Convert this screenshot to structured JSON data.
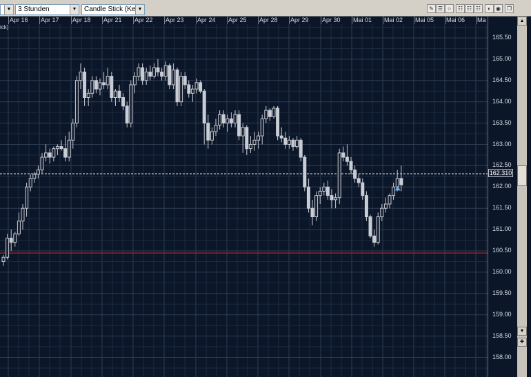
{
  "toolbar": {
    "interval": "3 Stunden",
    "chart_type": "Candle Stick (Kerze"
  },
  "date_labels": [
    "Apr 16",
    "Apr 17",
    "Apr 18",
    "Apr 21",
    "Apr 22",
    "Apr 23",
    "Apr 24",
    "Apr 25",
    "Apr 28",
    "Apr 29",
    "Apr 30",
    "Mai 01",
    "Mai 02",
    "Mai 05",
    "Mai 06",
    "Ma"
  ],
  "partial_label": "ick)",
  "price_labels": [
    "165.50",
    "165.00",
    "164.50",
    "164.00",
    "163.50",
    "163.00",
    "162.50",
    "162.00",
    "161.50",
    "161.00",
    "160.50",
    "160.00",
    "159.50",
    "159.00",
    "158.50",
    "158.00"
  ],
  "current_price": "162.310",
  "reference_price": 160.45,
  "colors": {
    "background": "#0b1628",
    "candle_up": "#1a2030",
    "candle_down": "#c8ccd4",
    "reference_line": "#b0242a",
    "current_line": "#ffffff",
    "marker": "#6fa8e8"
  },
  "chart_data": {
    "type": "candlestick",
    "ylim": [
      157.7,
      165.8
    ],
    "x_labels": [
      "Apr 16",
      "Apr 17",
      "Apr 18",
      "Apr 21",
      "Apr 22",
      "Apr 23",
      "Apr 24",
      "Apr 25",
      "Apr 28",
      "Apr 29",
      "Apr 30",
      "Mai 01",
      "Mai 02",
      "Mai 05",
      "Mai 06"
    ],
    "candles": [
      {
        "o": 160.25,
        "h": 160.4,
        "l": 160.15,
        "c": 160.35
      },
      {
        "o": 160.35,
        "h": 160.9,
        "l": 160.3,
        "c": 160.8
      },
      {
        "o": 160.8,
        "h": 161.0,
        "l": 160.5,
        "c": 160.7
      },
      {
        "o": 160.7,
        "h": 160.95,
        "l": 160.6,
        "c": 160.9
      },
      {
        "o": 160.9,
        "h": 161.4,
        "l": 160.85,
        "c": 161.2
      },
      {
        "o": 161.2,
        "h": 161.6,
        "l": 161.0,
        "c": 161.5
      },
      {
        "o": 161.5,
        "h": 162.1,
        "l": 161.3,
        "c": 162.0
      },
      {
        "o": 162.0,
        "h": 162.3,
        "l": 161.9,
        "c": 162.2
      },
      {
        "o": 162.2,
        "h": 162.35,
        "l": 162.1,
        "c": 162.3
      },
      {
        "o": 162.3,
        "h": 162.5,
        "l": 162.2,
        "c": 162.4
      },
      {
        "o": 162.4,
        "h": 162.8,
        "l": 162.3,
        "c": 162.7
      },
      {
        "o": 162.7,
        "h": 163.0,
        "l": 162.6,
        "c": 162.8
      },
      {
        "o": 162.8,
        "h": 162.9,
        "l": 162.55,
        "c": 162.7
      },
      {
        "o": 162.7,
        "h": 162.95,
        "l": 162.6,
        "c": 162.9
      },
      {
        "o": 162.9,
        "h": 163.0,
        "l": 162.75,
        "c": 162.95
      },
      {
        "o": 162.95,
        "h": 163.1,
        "l": 162.85,
        "c": 162.9
      },
      {
        "o": 162.9,
        "h": 163.2,
        "l": 162.6,
        "c": 162.7
      },
      {
        "o": 162.7,
        "h": 163.3,
        "l": 162.6,
        "c": 163.1
      },
      {
        "o": 163.1,
        "h": 163.6,
        "l": 162.9,
        "c": 163.5
      },
      {
        "o": 163.5,
        "h": 164.6,
        "l": 163.4,
        "c": 164.5
      },
      {
        "o": 164.5,
        "h": 164.9,
        "l": 164.3,
        "c": 164.7
      },
      {
        "o": 164.7,
        "h": 164.8,
        "l": 163.9,
        "c": 164.1
      },
      {
        "o": 164.1,
        "h": 164.3,
        "l": 163.9,
        "c": 164.2
      },
      {
        "o": 164.2,
        "h": 164.6,
        "l": 164.1,
        "c": 164.5
      },
      {
        "o": 164.5,
        "h": 164.6,
        "l": 164.2,
        "c": 164.3
      },
      {
        "o": 164.3,
        "h": 164.55,
        "l": 164.15,
        "c": 164.45
      },
      {
        "o": 164.45,
        "h": 164.7,
        "l": 164.3,
        "c": 164.4
      },
      {
        "o": 164.4,
        "h": 164.8,
        "l": 164.3,
        "c": 164.6
      },
      {
        "o": 164.6,
        "h": 164.7,
        "l": 164.0,
        "c": 164.1
      },
      {
        "o": 164.1,
        "h": 164.3,
        "l": 163.9,
        "c": 164.25
      },
      {
        "o": 164.25,
        "h": 164.4,
        "l": 164.0,
        "c": 164.1
      },
      {
        "o": 164.1,
        "h": 164.2,
        "l": 163.8,
        "c": 163.9
      },
      {
        "o": 163.9,
        "h": 164.0,
        "l": 163.4,
        "c": 163.5
      },
      {
        "o": 163.5,
        "h": 164.5,
        "l": 163.4,
        "c": 164.4
      },
      {
        "o": 164.4,
        "h": 164.7,
        "l": 164.2,
        "c": 164.6
      },
      {
        "o": 164.6,
        "h": 164.9,
        "l": 164.5,
        "c": 164.8
      },
      {
        "o": 164.8,
        "h": 164.9,
        "l": 164.4,
        "c": 164.5
      },
      {
        "o": 164.5,
        "h": 164.8,
        "l": 164.4,
        "c": 164.7
      },
      {
        "o": 164.7,
        "h": 164.85,
        "l": 164.5,
        "c": 164.6
      },
      {
        "o": 164.6,
        "h": 164.9,
        "l": 164.55,
        "c": 164.8
      },
      {
        "o": 164.8,
        "h": 165.0,
        "l": 164.6,
        "c": 164.7
      },
      {
        "o": 164.7,
        "h": 164.8,
        "l": 164.5,
        "c": 164.6
      },
      {
        "o": 164.6,
        "h": 164.95,
        "l": 164.5,
        "c": 164.85
      },
      {
        "o": 164.85,
        "h": 164.9,
        "l": 164.3,
        "c": 164.4
      },
      {
        "o": 164.4,
        "h": 164.9,
        "l": 164.3,
        "c": 164.75
      },
      {
        "o": 164.75,
        "h": 164.8,
        "l": 163.9,
        "c": 164.0
      },
      {
        "o": 164.0,
        "h": 164.7,
        "l": 163.9,
        "c": 164.6
      },
      {
        "o": 164.6,
        "h": 164.7,
        "l": 164.3,
        "c": 164.4
      },
      {
        "o": 164.4,
        "h": 164.5,
        "l": 164.1,
        "c": 164.2
      },
      {
        "o": 164.2,
        "h": 164.4,
        "l": 164.0,
        "c": 164.3
      },
      {
        "o": 164.3,
        "h": 164.55,
        "l": 164.2,
        "c": 164.45
      },
      {
        "o": 164.45,
        "h": 164.5,
        "l": 164.2,
        "c": 164.25
      },
      {
        "o": 164.25,
        "h": 164.3,
        "l": 163.0,
        "c": 163.5
      },
      {
        "o": 163.5,
        "h": 163.7,
        "l": 162.9,
        "c": 163.1
      },
      {
        "o": 163.1,
        "h": 163.4,
        "l": 163.0,
        "c": 163.3
      },
      {
        "o": 163.3,
        "h": 163.6,
        "l": 163.2,
        "c": 163.45
      },
      {
        "o": 163.45,
        "h": 163.8,
        "l": 163.35,
        "c": 163.7
      },
      {
        "o": 163.7,
        "h": 163.8,
        "l": 163.4,
        "c": 163.5
      },
      {
        "o": 163.5,
        "h": 163.7,
        "l": 163.3,
        "c": 163.6
      },
      {
        "o": 163.6,
        "h": 163.75,
        "l": 163.4,
        "c": 163.5
      },
      {
        "o": 163.5,
        "h": 163.8,
        "l": 163.4,
        "c": 163.7
      },
      {
        "o": 163.7,
        "h": 163.8,
        "l": 163.1,
        "c": 163.2
      },
      {
        "o": 163.2,
        "h": 163.5,
        "l": 162.8,
        "c": 163.4
      },
      {
        "o": 163.4,
        "h": 163.45,
        "l": 162.75,
        "c": 162.9
      },
      {
        "o": 162.9,
        "h": 163.2,
        "l": 162.8,
        "c": 163.0
      },
      {
        "o": 163.0,
        "h": 163.3,
        "l": 162.85,
        "c": 163.1
      },
      {
        "o": 163.1,
        "h": 163.3,
        "l": 162.9,
        "c": 163.2
      },
      {
        "o": 163.2,
        "h": 163.7,
        "l": 163.0,
        "c": 163.6
      },
      {
        "o": 163.6,
        "h": 163.9,
        "l": 163.5,
        "c": 163.8
      },
      {
        "o": 163.8,
        "h": 163.85,
        "l": 163.55,
        "c": 163.65
      },
      {
        "o": 163.65,
        "h": 163.9,
        "l": 163.6,
        "c": 163.85
      },
      {
        "o": 163.85,
        "h": 163.9,
        "l": 163.1,
        "c": 163.2
      },
      {
        "o": 163.2,
        "h": 163.4,
        "l": 163.05,
        "c": 163.15
      },
      {
        "o": 163.15,
        "h": 163.3,
        "l": 162.9,
        "c": 163.0
      },
      {
        "o": 163.0,
        "h": 163.2,
        "l": 162.9,
        "c": 163.1
      },
      {
        "o": 163.1,
        "h": 163.15,
        "l": 162.85,
        "c": 162.95
      },
      {
        "o": 162.95,
        "h": 163.2,
        "l": 162.9,
        "c": 163.1
      },
      {
        "o": 163.1,
        "h": 163.15,
        "l": 162.6,
        "c": 162.7
      },
      {
        "o": 162.7,
        "h": 162.75,
        "l": 161.9,
        "c": 162.0
      },
      {
        "o": 162.0,
        "h": 162.2,
        "l": 161.4,
        "c": 161.5
      },
      {
        "o": 161.5,
        "h": 161.7,
        "l": 161.1,
        "c": 161.3
      },
      {
        "o": 161.3,
        "h": 161.9,
        "l": 161.2,
        "c": 161.8
      },
      {
        "o": 161.8,
        "h": 162.0,
        "l": 161.6,
        "c": 161.9
      },
      {
        "o": 161.9,
        "h": 162.1,
        "l": 161.8,
        "c": 162.0
      },
      {
        "o": 162.0,
        "h": 162.15,
        "l": 161.7,
        "c": 161.8
      },
      {
        "o": 161.8,
        "h": 161.95,
        "l": 161.5,
        "c": 161.7
      },
      {
        "o": 161.7,
        "h": 161.85,
        "l": 161.5,
        "c": 161.75
      },
      {
        "o": 161.75,
        "h": 162.9,
        "l": 161.6,
        "c": 162.8
      },
      {
        "o": 162.8,
        "h": 162.95,
        "l": 162.6,
        "c": 162.7
      },
      {
        "o": 162.7,
        "h": 163.0,
        "l": 162.5,
        "c": 162.6
      },
      {
        "o": 162.6,
        "h": 162.7,
        "l": 162.3,
        "c": 162.4
      },
      {
        "o": 162.4,
        "h": 162.5,
        "l": 162.1,
        "c": 162.2
      },
      {
        "o": 162.2,
        "h": 162.3,
        "l": 162.0,
        "c": 162.1
      },
      {
        "o": 162.1,
        "h": 162.2,
        "l": 161.7,
        "c": 161.8
      },
      {
        "o": 161.8,
        "h": 161.9,
        "l": 161.2,
        "c": 161.3
      },
      {
        "o": 161.3,
        "h": 161.35,
        "l": 160.8,
        "c": 160.85
      },
      {
        "o": 160.85,
        "h": 161.0,
        "l": 160.6,
        "c": 160.7
      },
      {
        "o": 160.7,
        "h": 161.4,
        "l": 160.65,
        "c": 161.3
      },
      {
        "o": 161.3,
        "h": 161.6,
        "l": 161.2,
        "c": 161.5
      },
      {
        "o": 161.5,
        "h": 161.75,
        "l": 161.4,
        "c": 161.6
      },
      {
        "o": 161.6,
        "h": 161.85,
        "l": 161.5,
        "c": 161.8
      },
      {
        "o": 161.8,
        "h": 162.1,
        "l": 161.7,
        "c": 162.0
      },
      {
        "o": 162.0,
        "h": 162.4,
        "l": 161.9,
        "c": 162.2
      },
      {
        "o": 162.2,
        "h": 162.5,
        "l": 161.9,
        "c": 162.05
      }
    ]
  }
}
